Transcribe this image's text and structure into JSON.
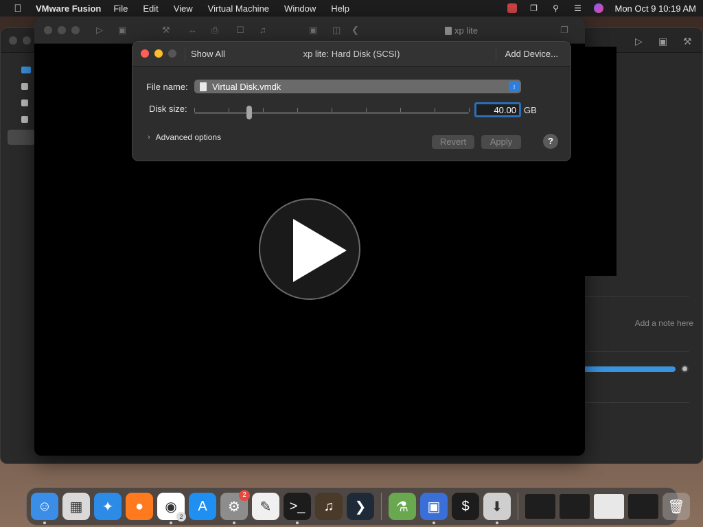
{
  "menubar": {
    "app_name": "VMware Fusion",
    "menus": [
      "File",
      "Edit",
      "View",
      "Virtual Machine",
      "Window",
      "Help"
    ],
    "datetime": "Mon Oct 9  10:19 AM"
  },
  "vm_window": {
    "title": "xp lite"
  },
  "background_window": {
    "note_placeholder": "Add a note here"
  },
  "dialog": {
    "title": "xp lite: Hard Disk (SCSI)",
    "show_all_label": "Show All",
    "add_device_label": "Add Device...",
    "file_name_label": "File name:",
    "file_name_value": "Virtual Disk.vmdk",
    "disk_size_label": "Disk size:",
    "disk_size_value": "40.00",
    "disk_size_unit": "GB",
    "disk_size_slider_fraction": 0.2,
    "advanced_label": "Advanced options",
    "revert_label": "Revert",
    "apply_label": "Apply",
    "help_label": "?",
    "accent_color": "#2f7ddc"
  },
  "dock": {
    "apps": [
      {
        "name": "finder-icon",
        "color": "#3b8ee8"
      },
      {
        "name": "launchpad-icon",
        "color": "#d9d9d9"
      },
      {
        "name": "safari-icon",
        "color": "#2b8be6"
      },
      {
        "name": "firefox-icon",
        "color": "#ff7a1f"
      },
      {
        "name": "chrome-icon",
        "color": "#ffffff",
        "badge": "2"
      },
      {
        "name": "app-store-icon",
        "color": "#1f8ff1"
      },
      {
        "name": "system-settings-icon",
        "color": "#8d8d8d",
        "badge": "2"
      },
      {
        "name": "textedit-icon",
        "color": "#f0f0f0"
      },
      {
        "name": "terminal-icon",
        "color": "#1c1c1c"
      },
      {
        "name": "garageband-icon",
        "color": "#4a3a2a"
      },
      {
        "name": "vscode-icon",
        "color": "#1f2a38"
      },
      {
        "name": "lab-flask-icon",
        "color": "#6aa84f"
      },
      {
        "name": "vmware-fusion-icon",
        "color": "#3a6fd8"
      },
      {
        "name": "activity-monitor-icon",
        "color": "#1c1c1c"
      },
      {
        "name": "downloads-icon",
        "color": "#cfcfcf"
      }
    ]
  }
}
